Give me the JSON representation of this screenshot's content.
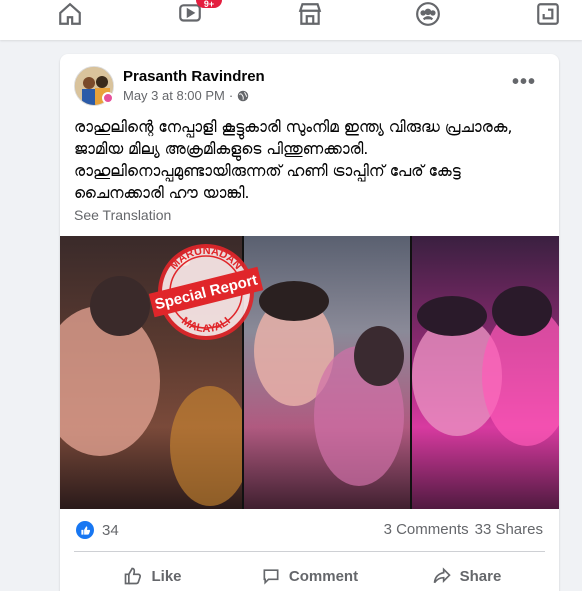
{
  "nav": {
    "items": [
      {
        "name": "home",
        "icon": "home-icon"
      },
      {
        "name": "watch",
        "icon": "video-icon",
        "badge": "9+"
      },
      {
        "name": "marketplace",
        "icon": "store-icon"
      },
      {
        "name": "groups",
        "icon": "groups-icon"
      },
      {
        "name": "gaming",
        "icon": "gaming-icon"
      }
    ]
  },
  "post": {
    "author": "Prasanth Ravindren",
    "timestamp": "May 3 at 8:00 PM",
    "separator": "·",
    "more_label": "•••",
    "text": "രാഹുലിന്റെ നേപ്പാളി കൂട്ടുകാരി സുംനിമ ഇന്ത്യ വിരുദ്ധ പ്രചാരക, ജാമിയ മില്യ അക്രമികളുടെ പിന്തുണക്കാരി. രാഹുലിനൊപ്പമുണ്ടായിരുന്നത് ഹണി ട്രാപ്പിന് പേര് കേട്ട ചൈനക്കാരി ഹൗ യാങ്കി.",
    "see_translation": "See Translation",
    "stamp": {
      "top_text": "MARUNADAN",
      "banner_text": "Special Report",
      "bottom_text": "MALAYALI",
      "color": "#e0262a"
    }
  },
  "stats": {
    "reactions_count": "34",
    "comments": "3 Comments",
    "shares": "33 Shares"
  },
  "actions": {
    "like": "Like",
    "comment": "Comment",
    "share": "Share"
  }
}
